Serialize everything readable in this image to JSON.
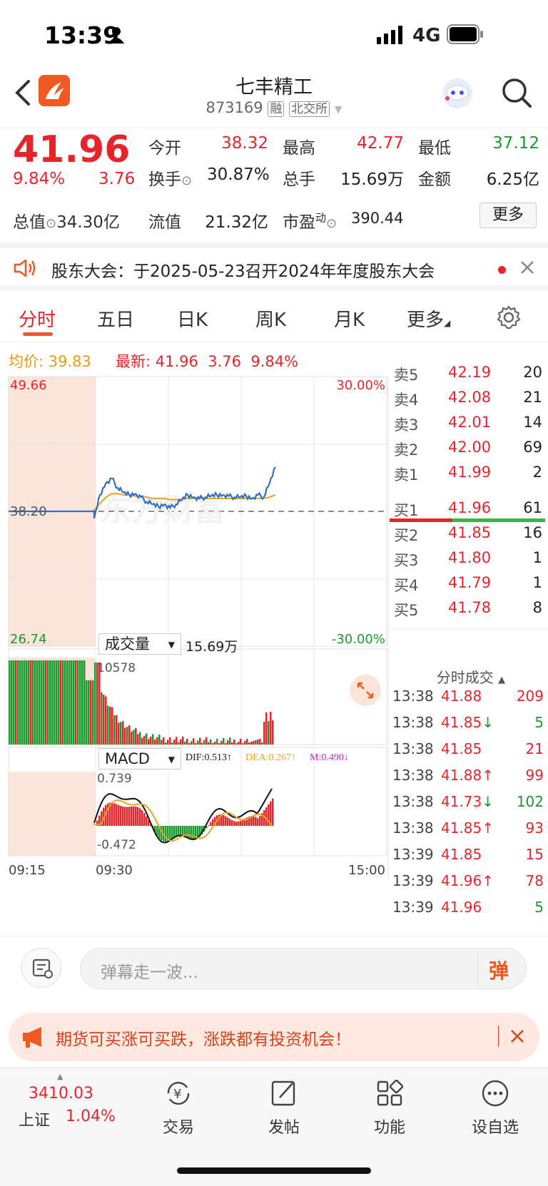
{
  "status": {
    "time": "13:39",
    "network": "4G"
  },
  "header": {
    "name": "七丰精工",
    "code": "873169",
    "tag1": "融",
    "tag2": "北交所"
  },
  "quote": {
    "price": "41.96",
    "pct": "9.84%",
    "chg": "3.76",
    "f": [
      {
        "l": "今开",
        "v": "38.32",
        "c": "red"
      },
      {
        "l": "最高",
        "v": "42.77",
        "c": "red"
      },
      {
        "l": "最低",
        "v": "37.12",
        "c": "green"
      },
      {
        "l": "换手",
        "v": "30.87%",
        "c": "dark"
      },
      {
        "l": "总手",
        "v": "15.69万",
        "c": "dark"
      },
      {
        "l": "金额",
        "v": "6.25亿",
        "c": "dark"
      }
    ],
    "mkt_label": "总值",
    "mkt_value": "34.30亿",
    "float_label": "流值",
    "float_value": "21.32亿",
    "pe_label": "市盈",
    "pe_sup": "动",
    "pe_value": "390.44",
    "more": "更多"
  },
  "notice": {
    "text": "股东大会：于2025-05-23召开2024年年度股东大会"
  },
  "tabs": [
    "分时",
    "五日",
    "日K",
    "周K",
    "月K",
    "更多"
  ],
  "info": {
    "avg_label": "均价:",
    "avg": "39.83",
    "last_label": "最新:",
    "last": "41.96",
    "chg": "3.76",
    "pct": "9.84%"
  },
  "chart": {
    "ymax": "49.66",
    "ymin": "26.74",
    "ymid": "38.20",
    "pmax": "30.00%",
    "pmin": "-30.00%",
    "watermark": "东方财富",
    "vol_label": "成交量",
    "vol_total": "15.69万",
    "vol_max": "10578",
    "macd_label": "MACD",
    "dif": "DIF:0.513↑",
    "dea": "DEA:0.267↑",
    "m": "M:0.490↓",
    "macd_max": "0.739",
    "macd_min": "-0.472",
    "t_start": "09:15",
    "t_open": "09:30",
    "t_end": "15:00"
  },
  "chart_data": {
    "type": "line",
    "series": [
      {
        "values": [
          38.2,
          38.2,
          37.6,
          39.6,
          40.6,
          41.0,
          40.2,
          39.8,
          39.6,
          39.7,
          39.4,
          39.0,
          38.8,
          38.6,
          38.8,
          38.5,
          38.8,
          39.2,
          39.6,
          39.4,
          39.3,
          39.4,
          39.5,
          39.6,
          39.6,
          39.5,
          39.4,
          39.4,
          39.5,
          39.3,
          39.6,
          39.4,
          40.6,
          41.96
        ]
      },
      {
        "values": [
          38.2,
          38.2,
          38.3,
          38.9,
          39.4,
          39.7,
          39.7,
          39.6,
          39.6,
          39.5,
          39.5,
          39.4,
          39.3,
          39.3,
          39.3,
          39.2,
          39.2,
          39.2,
          39.3,
          39.3,
          39.3,
          39.3,
          39.3,
          39.3,
          39.3,
          39.3,
          39.3,
          39.3,
          39.3,
          39.3,
          39.3,
          39.3,
          39.4,
          39.6
        ]
      }
    ]
  },
  "orderbook": {
    "sells": [
      [
        "卖5",
        "42.19",
        "20"
      ],
      [
        "卖4",
        "42.08",
        "21"
      ],
      [
        "卖3",
        "42.01",
        "14"
      ],
      [
        "卖2",
        "42.00",
        "69"
      ],
      [
        "卖1",
        "41.99",
        "2"
      ]
    ],
    "buys": [
      [
        "买1",
        "41.96",
        "61"
      ],
      [
        "买2",
        "41.85",
        "16"
      ],
      [
        "买3",
        "41.80",
        "1"
      ],
      [
        "买4",
        "41.79",
        "1"
      ],
      [
        "买5",
        "41.78",
        "8"
      ]
    ]
  },
  "trades": {
    "title": "分时成交",
    "rows": [
      [
        "13:38",
        "41.88",
        "",
        "209",
        "r"
      ],
      [
        "13:38",
        "41.85",
        "↓",
        "5",
        "g"
      ],
      [
        "13:38",
        "41.85",
        "",
        "21",
        "r"
      ],
      [
        "13:38",
        "41.88",
        "↑",
        "99",
        "r"
      ],
      [
        "13:38",
        "41.73",
        "↓",
        "102",
        "g"
      ],
      [
        "13:38",
        "41.85",
        "↑",
        "93",
        "r"
      ],
      [
        "13:39",
        "41.85",
        "",
        "15",
        "r"
      ],
      [
        "13:39",
        "41.96",
        "↑",
        "78",
        "r"
      ],
      [
        "13:39",
        "41.96",
        "",
        "5",
        "g"
      ]
    ]
  },
  "comment": {
    "placeholder": "弹幕走一波...",
    "btn": "弹"
  },
  "ad": {
    "text": "期货可买涨可买跌，涨跌都有投资机会！"
  },
  "bottom": {
    "index_value": "3410.03",
    "index_name": "上证",
    "index_pct": "1.04%",
    "items": [
      "交易",
      "发帖",
      "功能",
      "设自选"
    ]
  }
}
